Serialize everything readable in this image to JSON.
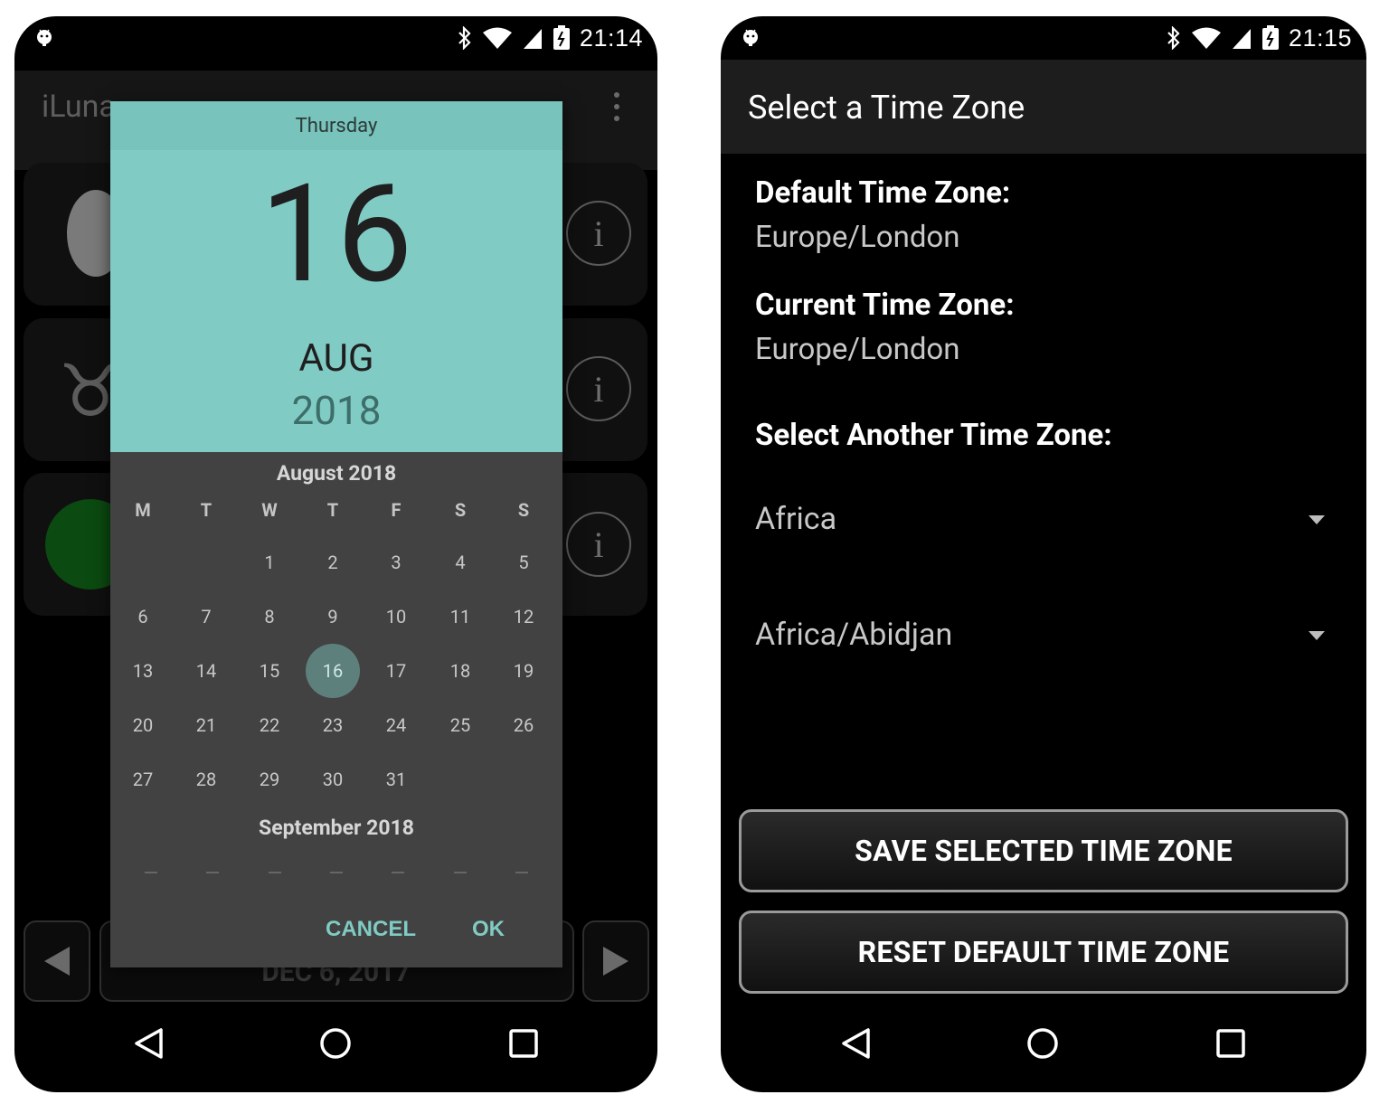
{
  "left_screen": {
    "status_time": "21:14",
    "app_title": "iLuna",
    "date_bar_text": "DEC 6, 2017",
    "date_picker": {
      "day_of_week": "Thursday",
      "day": "16",
      "month": "AUG",
      "year": "2018",
      "month_title": "August 2018",
      "next_month_title": "September 2018",
      "weekdays": [
        "M",
        "T",
        "W",
        "T",
        "F",
        "S",
        "S"
      ],
      "weeks": [
        [
          "",
          "",
          "1",
          "2",
          "3",
          "4",
          "5"
        ],
        [
          "6",
          "7",
          "8",
          "9",
          "10",
          "11",
          "12"
        ],
        [
          "13",
          "14",
          "15",
          "16",
          "17",
          "18",
          "19"
        ],
        [
          "20",
          "21",
          "22",
          "23",
          "24",
          "25",
          "26"
        ],
        [
          "27",
          "28",
          "29",
          "30",
          "31",
          "",
          ""
        ]
      ],
      "selected_day": "16",
      "cancel_label": "CANCEL",
      "ok_label": "OK"
    },
    "info_icon": "i"
  },
  "right_screen": {
    "status_time": "21:15",
    "title": "Select a Time Zone",
    "default_label": "Default Time Zone:",
    "default_value": "Europe/London",
    "current_label": "Current Time Zone:",
    "current_value": "Europe/London",
    "select_label": "Select Another Time Zone:",
    "region_selected": "Africa",
    "zone_selected": "Africa/Abidjan",
    "save_button": "SAVE SELECTED TIME ZONE",
    "reset_button": "RESET DEFAULT TIME ZONE"
  },
  "colors": {
    "accent": "#80cbc4",
    "dialog_bg": "#424242",
    "phone_bg": "#000000"
  },
  "icons": {
    "navigation": [
      "back-triangle-icon",
      "home-circle-icon",
      "recents-square-icon"
    ],
    "status": [
      "android-icon",
      "bluetooth-icon",
      "wifi-icon",
      "signal-icon",
      "battery-icon"
    ]
  }
}
